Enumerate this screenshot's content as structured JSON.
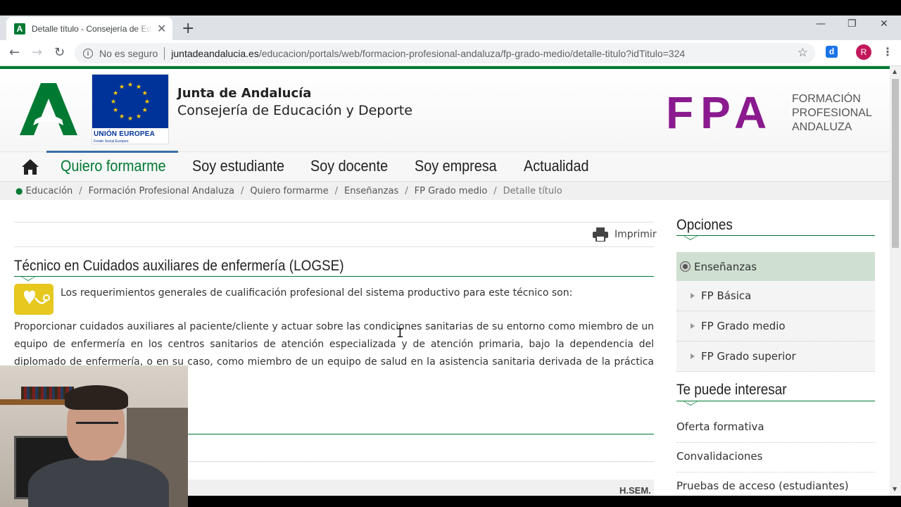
{
  "browser": {
    "tab_title": "Detalle título - Consejería de Educación y Deporte",
    "favicon_letter": "A",
    "new_tab_symbol": "+",
    "security_label": "No es seguro",
    "url_host": "juntadeandalucia.es",
    "url_path": "/educacion/portals/web/formacion-profesional-andaluza/fp-grado-medio/detalle-titulo?idTitulo=324",
    "extension_letter": "d",
    "profile_initial": "R"
  },
  "header": {
    "eu_label": "UNIÓN EUROPEA",
    "eu_sub": "Fondo Social Europeo",
    "org_title": "Junta de Andalucía",
    "org_subtitle": "Consejería de Educación y Deporte",
    "fpa_letters": "FPA",
    "fpa_line1": "FORMACIÓN",
    "fpa_line2": "PROFESIONAL",
    "fpa_line3": "ANDALUZA"
  },
  "nav": {
    "items": [
      "Quiero formarme",
      "Soy estudiante",
      "Soy docente",
      "Soy empresa",
      "Actualidad"
    ],
    "active_index": 0
  },
  "breadcrumbs": [
    "Educación",
    "Formación Profesional Andaluza",
    "Quiero formarme",
    "Enseñanzas",
    "FP Grado medio",
    "Detalle título"
  ],
  "content": {
    "print_label": "Imprimir",
    "title": "Técnico en Cuidados auxiliares de enfermería (LOGSE)",
    "intro": "Los requerimientos generales de cualificación profesional del sistema productivo para este técnico son:",
    "body": "Proporcionar cuidados auxiliares al paciente/cliente y actuar sobre las condiciones sanitarias de su entorno como miembro de un equipo de enfermería en los centros sanitarios de atención especializada y de atención primaria, bajo la dependencia del diplomado de enfermería, o en su caso, como miembro de un equipo de salud en la asistencia sanitaria derivada de la práctica del ejercicio liberal, bajo la",
    "table_header_right": "H.SEM."
  },
  "sidebar": {
    "options_heading": "Opciones",
    "options_main": "Enseñanzas",
    "options_sub": [
      "FP Básica",
      "FP Grado medio",
      "FP Grado superior"
    ],
    "interest_heading": "Te puede interesar",
    "interest_links": [
      "Oferta formativa",
      "Convalidaciones",
      "Pruebas de acceso (estudiantes)"
    ]
  },
  "colors": {
    "junta_green": "#007a33",
    "fpa_purple": "#8a1a8e",
    "eu_blue": "#003399",
    "sidebar_selected": "#cfe0d1"
  }
}
